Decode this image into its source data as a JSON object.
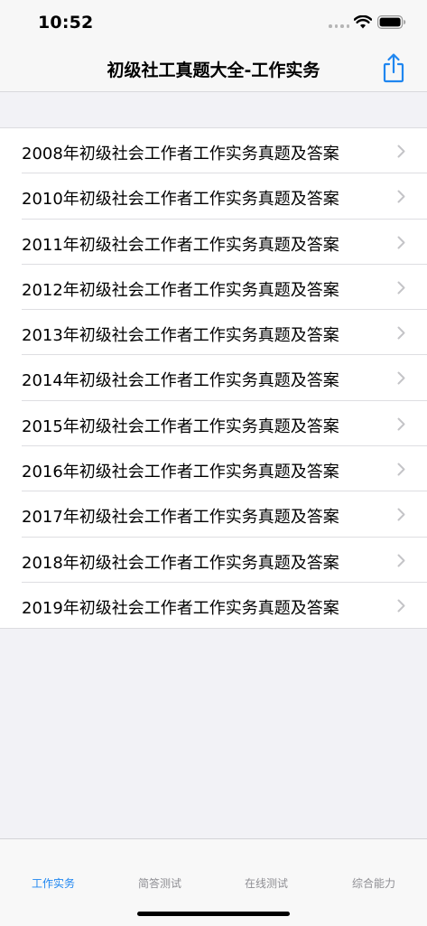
{
  "status_bar": {
    "time": "10:52"
  },
  "nav": {
    "title": "初级社工真题大全-工作实务",
    "share_icon": "share-icon"
  },
  "list": {
    "items": [
      {
        "label": "2008年初级社会工作者工作实务真题及答案"
      },
      {
        "label": "2010年初级社会工作者工作实务真题及答案"
      },
      {
        "label": "2011年初级社会工作者工作实务真题及答案"
      },
      {
        "label": "2012年初级社会工作者工作实务真题及答案"
      },
      {
        "label": "2013年初级社会工作者工作实务真题及答案"
      },
      {
        "label": "2014年初级社会工作者工作实务真题及答案"
      },
      {
        "label": "2015年初级社会工作者工作实务真题及答案"
      },
      {
        "label": "2016年初级社会工作者工作实务真题及答案"
      },
      {
        "label": "2017年初级社会工作者工作实务真题及答案"
      },
      {
        "label": "2018年初级社会工作者工作实务真题及答案"
      },
      {
        "label": "2019年初级社会工作者工作实务真题及答案"
      }
    ]
  },
  "tabs": [
    {
      "label": "工作实务",
      "active": true
    },
    {
      "label": "简答测试",
      "active": false
    },
    {
      "label": "在线测试",
      "active": false
    },
    {
      "label": "综合能力",
      "active": false
    }
  ],
  "colors": {
    "accent": "#1f86f0",
    "inactive_tab": "#8e8e93",
    "background": "#f2f2f6"
  }
}
